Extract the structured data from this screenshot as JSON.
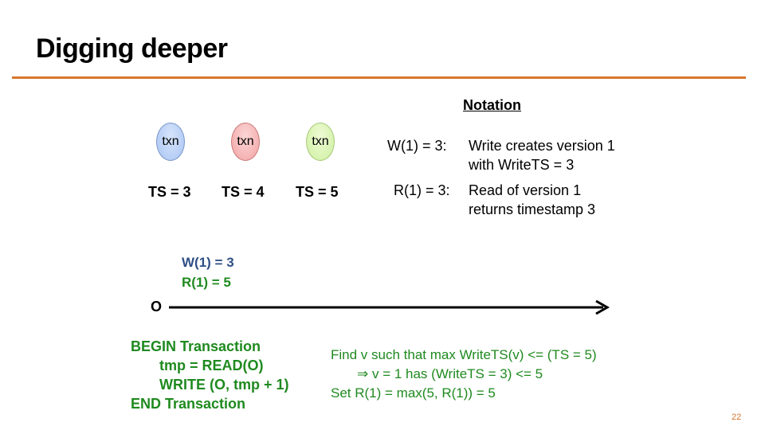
{
  "slide": {
    "title": "Digging deeper",
    "page_number": "22",
    "accent_color": "#d9772f"
  },
  "transactions": [
    {
      "label": "txn",
      "ts": "TS = 3",
      "color": "blue"
    },
    {
      "label": "txn",
      "ts": "TS = 4",
      "color": "red"
    },
    {
      "label": "txn",
      "ts": "TS = 5",
      "color": "green"
    }
  ],
  "notation": {
    "heading": "Notation",
    "items": [
      {
        "key": "W(1) = 3:",
        "line1": "Write creates version 1",
        "line2": "with WriteTS = 3"
      },
      {
        "key": "R(1) = 3:",
        "line1": "Read of version 1",
        "line2": "returns timestamp 3"
      }
    ]
  },
  "timeline": {
    "object_label": "O",
    "version_write": "W(1) = 3",
    "version_read": "R(1) = 5"
  },
  "code": {
    "lines": [
      "BEGIN Transaction",
      "tmp = READ(O)",
      "WRITE (O, tmp + 1)",
      "END Transaction"
    ]
  },
  "explanation": {
    "lines": [
      "Find v such that max WriteTS(v) <= (TS = 5)",
      "⇒  v = 1 has (WriteTS = 3) <= 5",
      "Set R(1) = max(5, R(1)) = 5"
    ]
  }
}
